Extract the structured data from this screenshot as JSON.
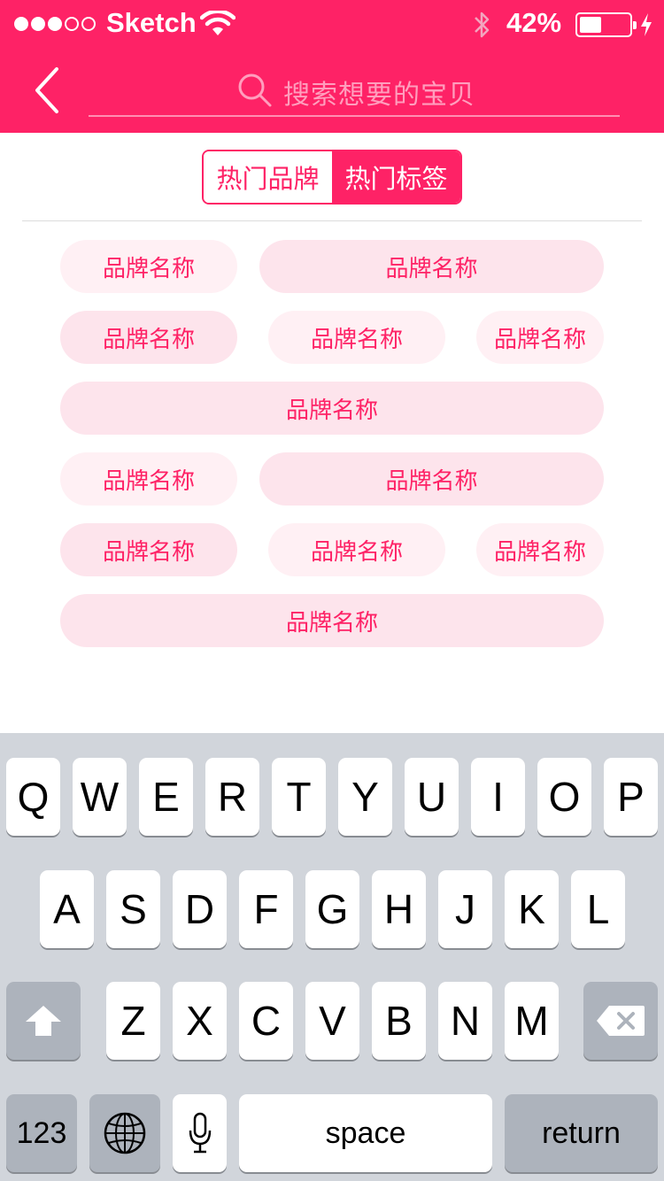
{
  "status_bar": {
    "carrier": "Sketch",
    "battery_percent": "42%",
    "battery_level": 0.42,
    "signal_bars_filled": 3,
    "signal_bars_total": 5
  },
  "nav": {
    "back_icon": "chevron-left-icon",
    "search_icon": "search-icon",
    "search_placeholder": "搜索想要的宝贝"
  },
  "tabs": {
    "items": [
      {
        "label": "热门品牌",
        "active": false
      },
      {
        "label": "热门标签",
        "active": true
      }
    ]
  },
  "tags": [
    {
      "label": "品牌名称"
    },
    {
      "label": "品牌名称"
    },
    {
      "label": "品牌名称"
    },
    {
      "label": "品牌名称"
    },
    {
      "label": "品牌名称"
    },
    {
      "label": "品牌名称"
    },
    {
      "label": "品牌名称"
    },
    {
      "label": "品牌名称"
    },
    {
      "label": "品牌名称"
    },
    {
      "label": "品牌名称"
    },
    {
      "label": "品牌名称"
    },
    {
      "label": "品牌名称"
    }
  ],
  "keyboard": {
    "row1": [
      "Q",
      "W",
      "E",
      "R",
      "T",
      "Y",
      "U",
      "I",
      "O",
      "P"
    ],
    "row2": [
      "A",
      "S",
      "D",
      "F",
      "G",
      "H",
      "J",
      "K",
      "L"
    ],
    "row3": [
      "Z",
      "X",
      "C",
      "V",
      "B",
      "N",
      "M"
    ],
    "numbers_label": "123",
    "space_label": "space",
    "return_label": "return",
    "shift_icon": "shift-arrow-icon",
    "delete_icon": "backspace-icon",
    "globe_icon": "globe-icon",
    "mic_icon": "microphone-icon"
  },
  "colors": {
    "accent": "#fe2266",
    "tag_light": "#fff0f4",
    "tag_mid": "#fde4ec",
    "keyboard_bg": "#d1d5db",
    "key_dark": "#adb3bc"
  }
}
